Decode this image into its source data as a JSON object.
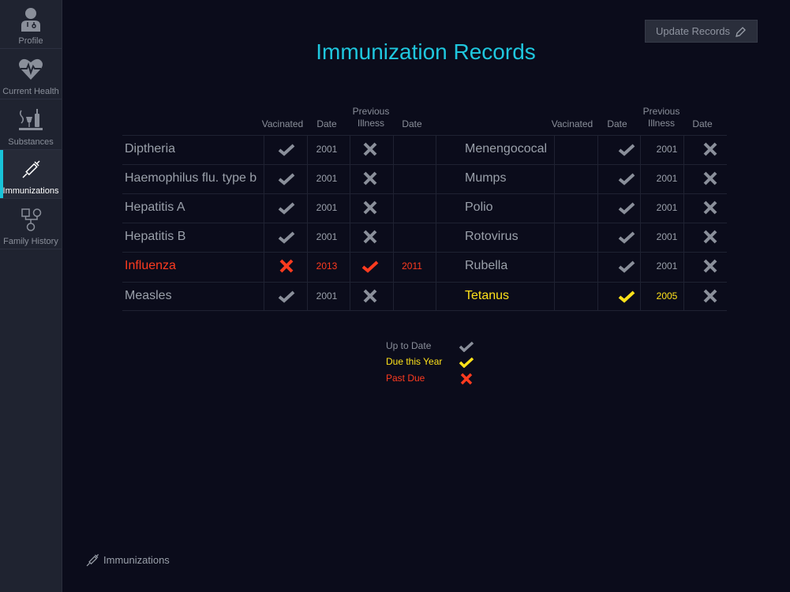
{
  "sidebar": {
    "items": [
      {
        "label": "Profile",
        "icon": "doctor-icon"
      },
      {
        "label": "Current Health",
        "icon": "heart-pulse-icon"
      },
      {
        "label": "Substances",
        "icon": "substances-icon"
      },
      {
        "label": "Immunizations",
        "icon": "syringe-icon",
        "active": true
      },
      {
        "label": "Family History",
        "icon": "family-tree-icon"
      }
    ]
  },
  "page": {
    "title": "Immunization Records",
    "update_button": "Update Records"
  },
  "table": {
    "headers": {
      "vaccinated": "Vacinated",
      "date": "Date",
      "previous_illness": "Previous Illness"
    },
    "left": [
      {
        "name": "Diptheria",
        "vaccinated": "check",
        "date": "2001",
        "illness": "x",
        "illness_date": "",
        "status": "up-to-date"
      },
      {
        "name": "Haemophilus flu. type b",
        "vaccinated": "check",
        "date": "2001",
        "illness": "x",
        "illness_date": "",
        "status": "up-to-date"
      },
      {
        "name": "Hepatitis A",
        "vaccinated": "check",
        "date": "2001",
        "illness": "x",
        "illness_date": "",
        "status": "up-to-date"
      },
      {
        "name": "Hepatitis B",
        "vaccinated": "check",
        "date": "2001",
        "illness": "x",
        "illness_date": "",
        "status": "up-to-date"
      },
      {
        "name": "Influenza",
        "vaccinated": "x",
        "date": "2013",
        "illness": "check",
        "illness_date": "2011",
        "status": "past-due"
      },
      {
        "name": "Measles",
        "vaccinated": "check",
        "date": "2001",
        "illness": "x",
        "illness_date": "",
        "status": "up-to-date"
      }
    ],
    "right": [
      {
        "name": "Menengococal",
        "vaccinated": "check",
        "date": "2001",
        "illness": "x",
        "illness_date": "",
        "status": "up-to-date"
      },
      {
        "name": "Mumps",
        "vaccinated": "check",
        "date": "2001",
        "illness": "x",
        "illness_date": "",
        "status": "up-to-date"
      },
      {
        "name": "Polio",
        "vaccinated": "check",
        "date": "2001",
        "illness": "x",
        "illness_date": "",
        "status": "up-to-date"
      },
      {
        "name": "Rotovirus",
        "vaccinated": "check",
        "date": "2001",
        "illness": "x",
        "illness_date": "",
        "status": "up-to-date"
      },
      {
        "name": "Rubella",
        "vaccinated": "check",
        "date": "2001",
        "illness": "x",
        "illness_date": "",
        "status": "up-to-date"
      },
      {
        "name": "Tetanus",
        "vaccinated": "check",
        "date": "2005",
        "illness": "x",
        "illness_date": "",
        "status": "due-this-year"
      }
    ]
  },
  "legend": [
    {
      "label": "Up to Date",
      "mark": "check",
      "status": "up-to-date"
    },
    {
      "label": "Due this Year",
      "mark": "check",
      "status": "due-this-year"
    },
    {
      "label": "Past Due",
      "mark": "x",
      "status": "past-due"
    }
  ],
  "footer": {
    "label": "Immunizations",
    "icon": "syringe-icon"
  },
  "colors": {
    "accent": "#1fc7de",
    "up_to_date": "#8a8f9a",
    "due_this_year": "#ffe21a",
    "past_due": "#ff3b1f"
  }
}
